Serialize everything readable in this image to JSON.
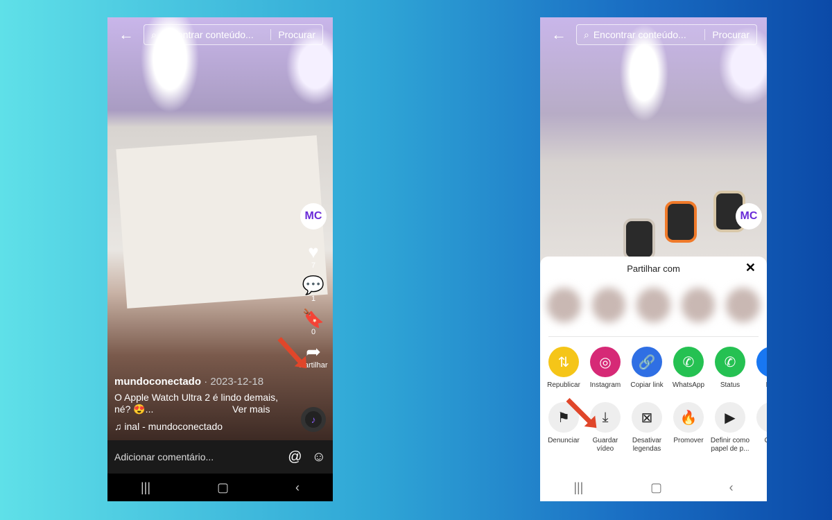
{
  "search": {
    "placeholder": "Encontrar conteúdo...",
    "button": "Procurar"
  },
  "left": {
    "avatar": "MC",
    "likes": "7",
    "comments": "1",
    "saves": "0",
    "share_label": "Partilhar",
    "username": "mundoconectado",
    "date": "· 2023-12-18",
    "caption": "O Apple Watch Ultra 2 é lindo demais, né? 😍...",
    "more": "Ver mais",
    "music": "♫ inal - mundoconectado",
    "comment_placeholder": "Adicionar comentário..."
  },
  "right": {
    "avatar": "MC",
    "sheet_title": "Partilhar com",
    "share_targets": [
      {
        "label": "Republicar",
        "color": "#f5c518",
        "icon": "⇅"
      },
      {
        "label": "Instagram",
        "color": "#d62976",
        "icon": "◎"
      },
      {
        "label": "Copiar link",
        "color": "#2f6fe4",
        "icon": "🔗"
      },
      {
        "label": "WhatsApp",
        "color": "#25c152",
        "icon": "✆"
      },
      {
        "label": "Status",
        "color": "#25c152",
        "icon": "✆"
      },
      {
        "label": "Fac",
        "color": "#1877f2",
        "icon": "f"
      }
    ],
    "actions": [
      {
        "label": "Denunciar",
        "icon": "⚑"
      },
      {
        "label": "Guardar vídeo",
        "icon": "⤓"
      },
      {
        "label": "Desativar legendas",
        "icon": "⊠"
      },
      {
        "label": "Promover",
        "icon": "🔥"
      },
      {
        "label": "Definir como papel de p...",
        "icon": "▶"
      },
      {
        "label": "C ad",
        "icon": "·"
      }
    ]
  },
  "nav": {
    "recent": "|||",
    "home": "▢",
    "back": "‹"
  },
  "colors": {
    "arrow": "#e0462a"
  }
}
